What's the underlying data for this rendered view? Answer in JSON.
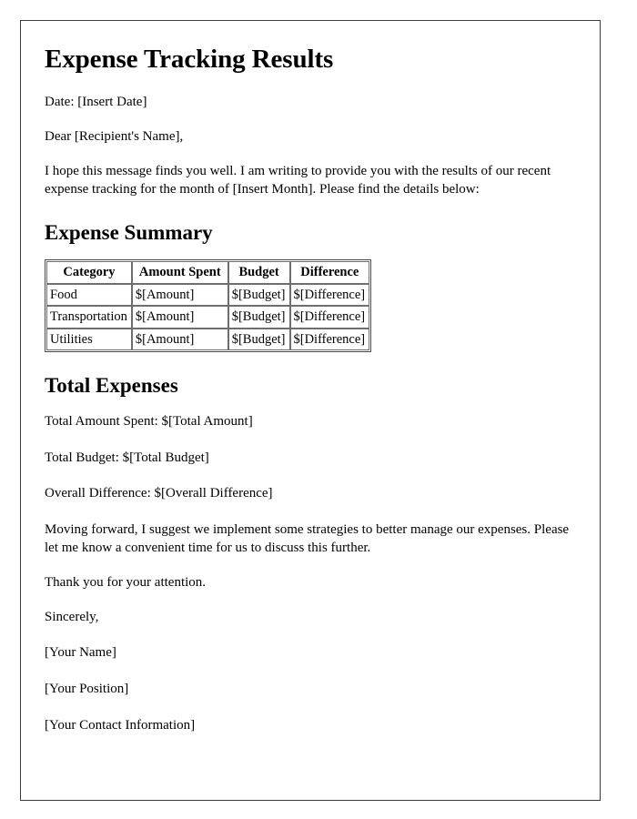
{
  "document": {
    "title": "Expense Tracking Results",
    "date_line": "Date: [Insert Date]",
    "salutation": "Dear [Recipient's Name],",
    "intro": "I hope this message finds you well. I am writing to provide you with the results of our recent expense tracking for the month of [Insert Month]. Please find the details below:"
  },
  "expense_summary": {
    "heading": "Expense Summary",
    "columns": [
      "Category",
      "Amount Spent",
      "Budget",
      "Difference"
    ],
    "rows": [
      [
        "Food",
        "$[Amount]",
        "$[Budget]",
        "$[Difference]"
      ],
      [
        "Transportation",
        "$[Amount]",
        "$[Budget]",
        "$[Difference]"
      ],
      [
        "Utilities",
        "$[Amount]",
        "$[Budget]",
        "$[Difference]"
      ]
    ]
  },
  "total_expenses": {
    "heading": "Total Expenses",
    "total_amount_spent": "Total Amount Spent: $[Total Amount]",
    "total_budget": "Total Budget: $[Total Budget]",
    "overall_difference": "Overall Difference: $[Overall Difference]"
  },
  "closing": {
    "recommendation": "Moving forward, I suggest we implement some strategies to better manage our expenses. Please let me know a convenient time for us to discuss this further.",
    "thanks": "Thank you for your attention.",
    "signoff": "Sincerely,",
    "name": "[Your Name]",
    "position": "[Your Position]",
    "contact": "[Your Contact Information]"
  }
}
